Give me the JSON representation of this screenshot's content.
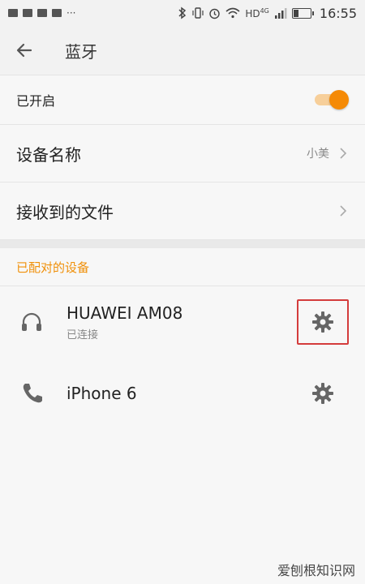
{
  "statusbar": {
    "left_more": "···",
    "network": "HD",
    "network_gen": "4G",
    "time": "16:55"
  },
  "appbar": {
    "title": "蓝牙"
  },
  "settings": [
    {
      "label": "已开启",
      "type": "toggle",
      "on": true
    },
    {
      "label": "设备名称",
      "value": "小美"
    },
    {
      "label": "接收到的文件"
    }
  ],
  "paired": {
    "header": "已配对的设备",
    "devices": [
      {
        "name": "HUAWEI AM08",
        "status": "已连接",
        "icon": "headphones-icon"
      },
      {
        "name": "iPhone 6",
        "status": "",
        "icon": "phone-icon"
      }
    ]
  },
  "watermark": "爱刨根知识网",
  "colors": {
    "accent": "#f58a06",
    "highlight": "#d43c3c"
  }
}
